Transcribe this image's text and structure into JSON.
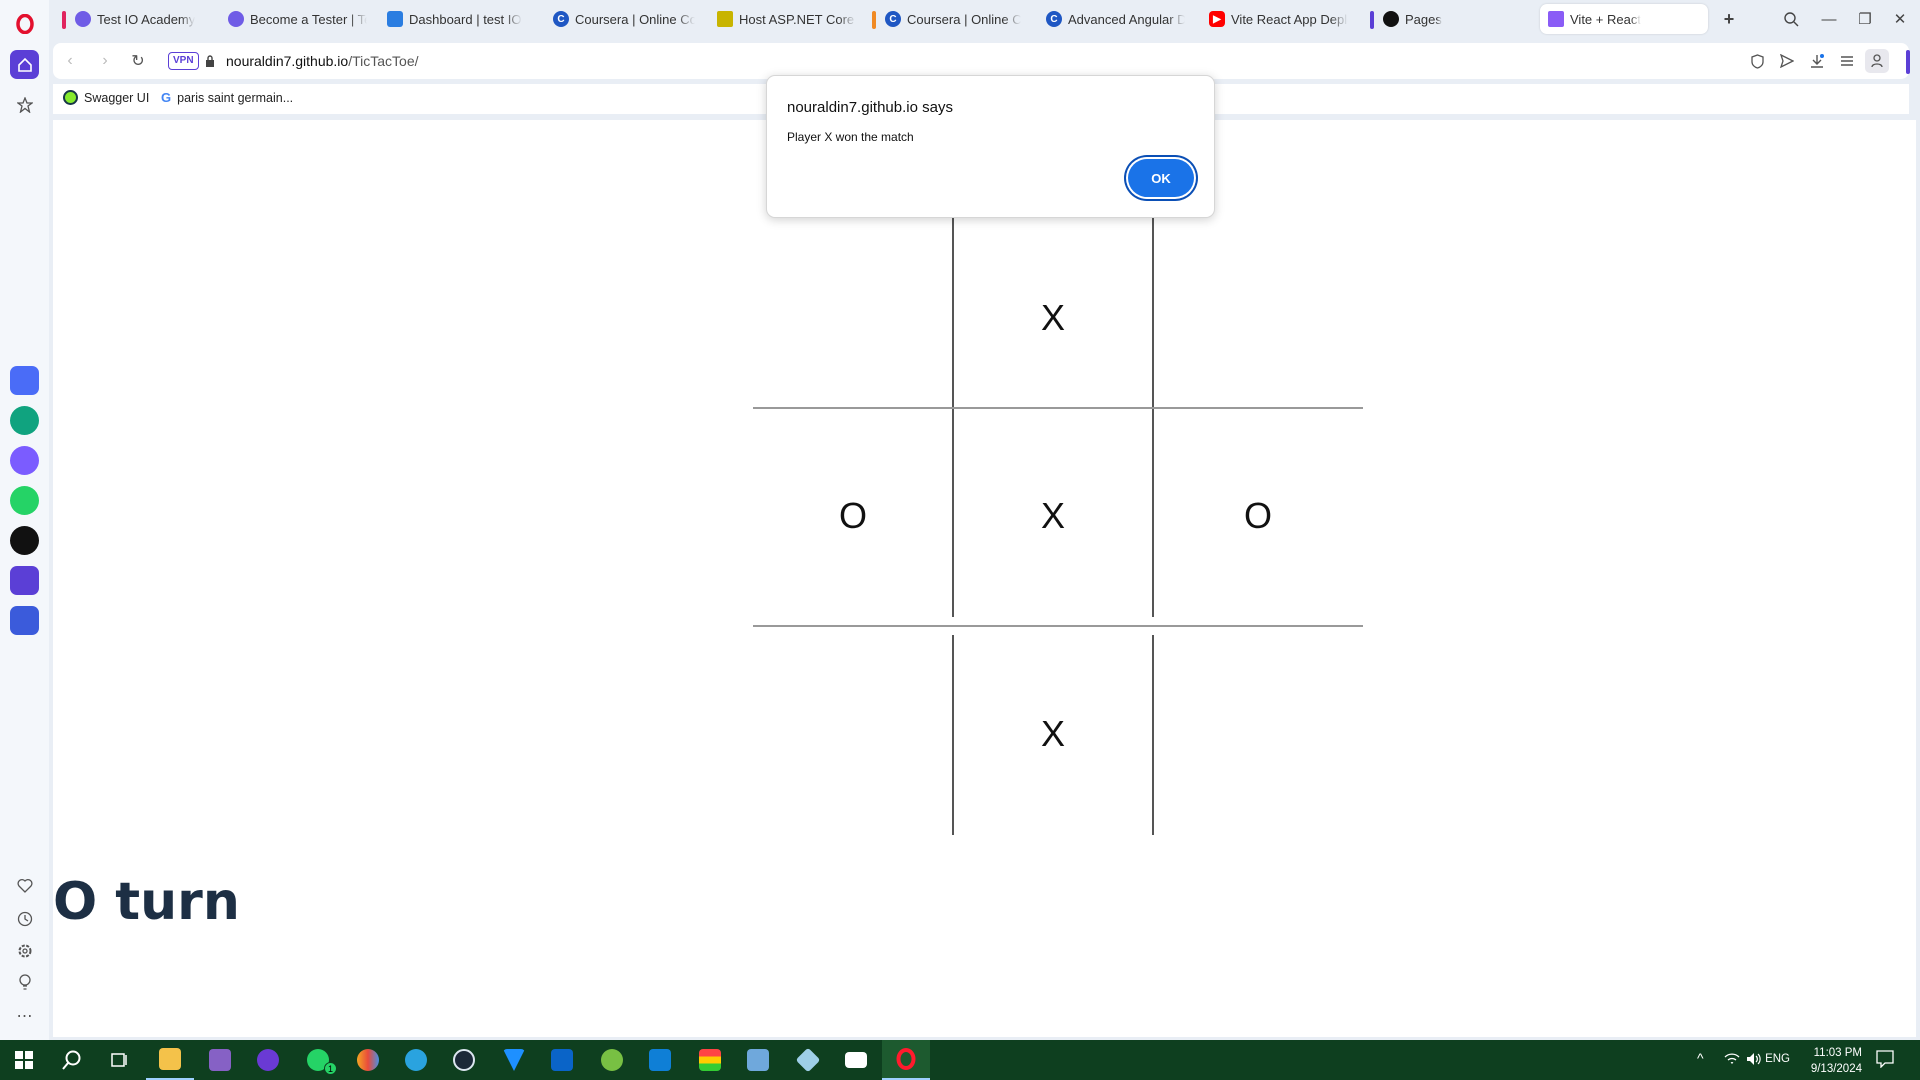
{
  "browser": {
    "tabs": [
      {
        "title": "Test IO Academy",
        "favicon_color": "#6f5ce6",
        "bar_color": "#e0245e"
      },
      {
        "title": "Become a Tester | Test IO",
        "favicon_color": "#6f5ce6"
      },
      {
        "title": "Dashboard | test IO",
        "favicon_color": "#2a7de1"
      },
      {
        "title": "Coursera | Online Courses",
        "favicon_color": "#1f57c3"
      },
      {
        "title": "Host ASP.NET Core on A",
        "favicon_color": "#c8b400"
      },
      {
        "title": "Coursera | Online Courses",
        "favicon_color": "#1f57c3",
        "bar_color": "#f08a24"
      },
      {
        "title": "Advanced Angular Deve",
        "favicon_color": "#1f57c3"
      },
      {
        "title": "Vite React App Deploy C",
        "favicon_color": "#ff0000"
      },
      {
        "title": "Pages",
        "favicon_color": "#111111",
        "bar_color": "#5b3fd6"
      },
      {
        "title": "Vite + React",
        "favicon_color": "#8a5cf6",
        "active": true
      }
    ],
    "vpn_label": "VPN",
    "url_host": "nouraldin7.github.io",
    "url_path": "/TicTacToe/",
    "bookmarks": [
      {
        "label": "Swagger UI",
        "icon": "swagger-icon"
      },
      {
        "label": "paris saint germain...",
        "icon": "google-icon"
      }
    ]
  },
  "game": {
    "board": [
      "",
      "X",
      "",
      "O",
      "X",
      "O",
      "",
      "X",
      ""
    ],
    "status": "O turn"
  },
  "dialog": {
    "title": "nouraldin7.github.io says",
    "message": "Player X won the match",
    "ok_label": "OK"
  },
  "taskbar": {
    "lang": "ENG",
    "time": "11:03 PM",
    "date": "9/13/2024",
    "whatsapp_badge": "1"
  },
  "colors": {
    "accent": "#1a73e8",
    "taskbar": "#0e3f1f",
    "status_text": "#1d2f44"
  }
}
